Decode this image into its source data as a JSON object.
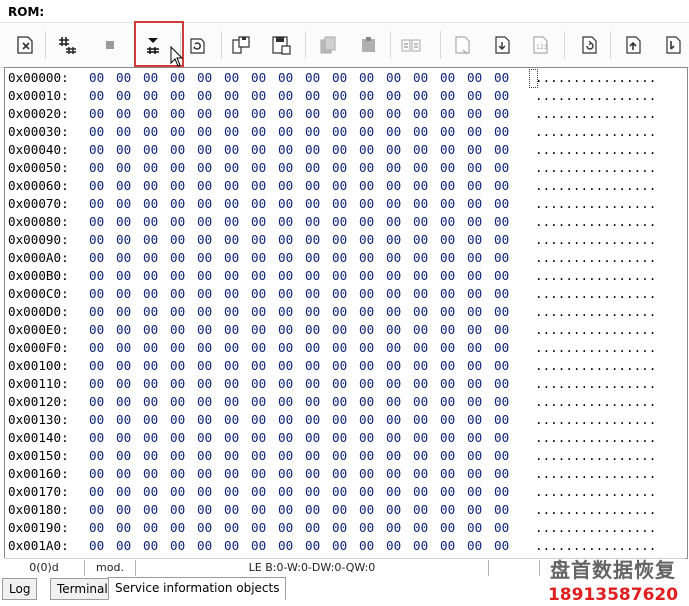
{
  "window": {
    "title": "ROM:"
  },
  "toolbar": {
    "buttons": [
      {
        "name": "clear-rom-icon"
      },
      {
        "name": "hash-config-icon"
      },
      {
        "name": "stop-icon"
      },
      {
        "name": "read-dropdown-icon"
      },
      {
        "name": "refresh-icon"
      },
      {
        "name": "save-icon"
      },
      {
        "name": "save-as-icon"
      },
      {
        "name": "copy-icon"
      },
      {
        "name": "paste-icon"
      },
      {
        "name": "compare-icon"
      },
      {
        "name": "new-file-icon"
      },
      {
        "name": "download-icon"
      },
      {
        "name": "numbers-icon"
      },
      {
        "name": "reload-icon"
      },
      {
        "name": "upload-icon"
      },
      {
        "name": "move-down-icon"
      }
    ]
  },
  "hex": {
    "rows": [
      {
        "addr": "0x00000:"
      },
      {
        "addr": "0x00010:"
      },
      {
        "addr": "0x00020:"
      },
      {
        "addr": "0x00030:"
      },
      {
        "addr": "0x00040:"
      },
      {
        "addr": "0x00050:"
      },
      {
        "addr": "0x00060:"
      },
      {
        "addr": "0x00070:"
      },
      {
        "addr": "0x00080:"
      },
      {
        "addr": "0x00090:"
      },
      {
        "addr": "0x000A0:"
      },
      {
        "addr": "0x000B0:"
      },
      {
        "addr": "0x000C0:"
      },
      {
        "addr": "0x000D0:"
      },
      {
        "addr": "0x000E0:"
      },
      {
        "addr": "0x000F0:"
      },
      {
        "addr": "0x00100:"
      },
      {
        "addr": "0x00110:"
      },
      {
        "addr": "0x00120:"
      },
      {
        "addr": "0x00130:"
      },
      {
        "addr": "0x00140:"
      },
      {
        "addr": "0x00150:"
      },
      {
        "addr": "0x00160:"
      },
      {
        "addr": "0x00170:"
      },
      {
        "addr": "0x00180:"
      },
      {
        "addr": "0x00190:"
      },
      {
        "addr": "0x001A0:"
      }
    ],
    "byte_value": "00",
    "ascii_value": "................"
  },
  "status": {
    "position": "0(0)d",
    "modified": "mod.",
    "endian": "LE B:0-W:0-DW:0-QW:0"
  },
  "tabs": [
    {
      "label": "Log"
    },
    {
      "label": "Terminal"
    },
    {
      "label": "Service information objects"
    }
  ],
  "watermark": {
    "line1": "盘首数据恢复",
    "line2": "18913587620"
  },
  "colors": {
    "byte": "#0b237a",
    "highlight": "#d23b3b"
  }
}
